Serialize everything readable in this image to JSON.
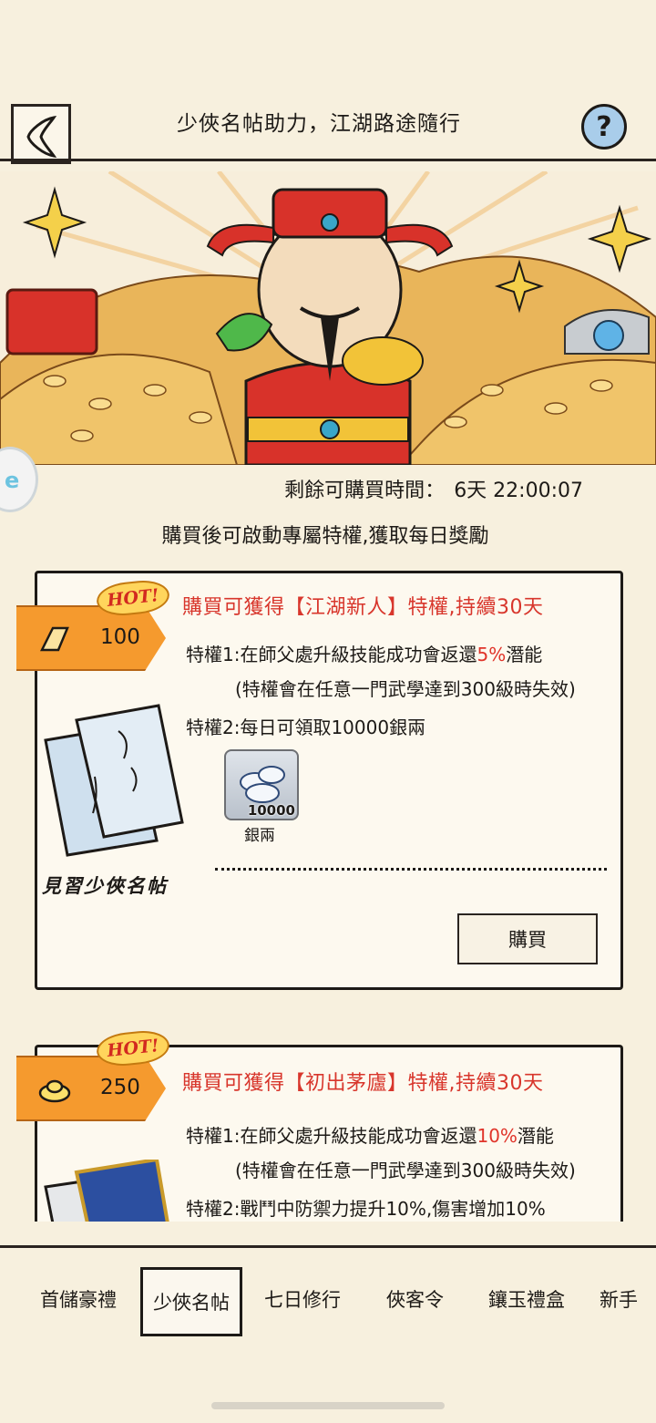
{
  "header": {
    "title": "少俠名帖助力，江湖路途隨行",
    "help_glyph": "?"
  },
  "remaining": {
    "label": "剩餘可購買時間：",
    "value": "6天 22:00:07"
  },
  "subtitle": "購買後可啟動專屬特權,獲取每日獎勵",
  "cards": [
    {
      "hot": "HOT!",
      "price": "100",
      "price_icon": "gold-bar-icon",
      "title": "購買可獲得【江湖新人】特權,持續30天",
      "perk1_pre": "特權1:在師父處升級技能成功會返還",
      "perk1_pct": "5%",
      "perk1_post": "潛能",
      "perk1_note": "(特權會在任意一門武學達到300級時失效)",
      "perk2": "特權2:每日可領取10000銀兩",
      "item": {
        "icon": "silver-ingot-icon",
        "count": "10000",
        "name": "銀兩"
      },
      "caption": "見習少俠名帖",
      "buy_label": "購買"
    },
    {
      "hot": "HOT!",
      "price": "250",
      "price_icon": "gold-ingot-icon",
      "title": "購買可獲得【初出茅廬】特權,持續30天",
      "perk1_pre": "特權1:在師父處升級技能成功會返還",
      "perk1_pct": "10%",
      "perk1_post": "潛能",
      "perk1_note": "(特權會在任意一門武學達到300級時失效)",
      "perk2": "特權2:戰鬥中防禦力提升10%,傷害增加10%"
    }
  ],
  "nav": {
    "items": [
      "首儲豪禮",
      "少俠名帖",
      "七日修行",
      "俠客令",
      "鑲玉禮盒",
      "新手"
    ],
    "active_index": 1
  },
  "colors": {
    "accent_red": "#d8362c",
    "tag_orange": "#f59a2e",
    "paper": "#f7f0de"
  }
}
